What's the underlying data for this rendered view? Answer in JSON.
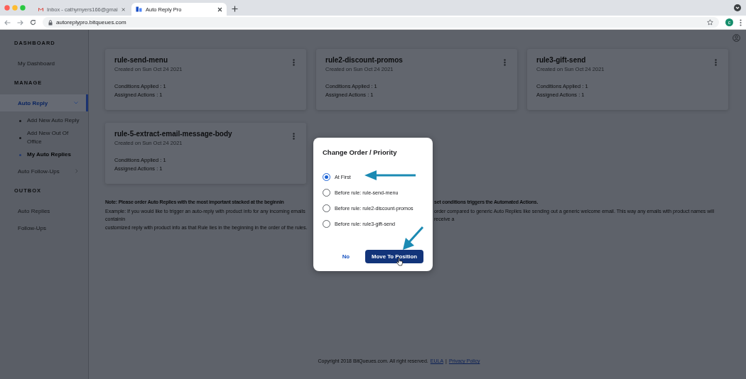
{
  "browser": {
    "tabs": [
      {
        "title": "Inbox - cathymyers166@gmai",
        "selected": false
      },
      {
        "title": "Auto Reply Pro",
        "selected": true
      }
    ],
    "url": "autoreplypro.bitqueues.com",
    "profile_initial": "c"
  },
  "sidebar": {
    "sections": [
      {
        "heading": "DASHBOARD",
        "items": [
          {
            "label": "My Dashboard",
            "selected": false
          }
        ]
      },
      {
        "heading": "MANAGE",
        "items": [
          {
            "label": "Auto Reply",
            "selected": true,
            "expanded": true,
            "children": [
              {
                "label": "Add New Auto Reply",
                "selected": false
              },
              {
                "label": "Add New Out Of Office",
                "selected": false
              },
              {
                "label": "My Auto Replies",
                "selected": true
              }
            ]
          },
          {
            "label": "Auto Follow-Ups",
            "selected": false,
            "expanded": false
          }
        ]
      },
      {
        "heading": "OUTBOX",
        "items": [
          {
            "label": "Auto Replies",
            "selected": false
          },
          {
            "label": "Follow-Ups",
            "selected": false
          }
        ]
      }
    ]
  },
  "rules": [
    {
      "name": "rule-send-menu",
      "created": "Created on Sun Oct 24 2021",
      "conditions": "Conditions Applied : 1",
      "actions": "Assigned Actions : 1"
    },
    {
      "name": "rule2-discount-promos",
      "created": "Created on Sun Oct 24 2021",
      "conditions": "Conditions Applied : 1",
      "actions": "Assigned Actions : 1"
    },
    {
      "name": "rule3-gift-send",
      "created": "Created on Sun Oct 24 2021",
      "conditions": "Conditions Applied : 1",
      "actions": "Assigned Actions : 1"
    },
    {
      "name": "rule-5-extract-email-message-body",
      "created": "Created on Sun Oct 24 2021",
      "conditions": "Conditions Applied : 1",
      "actions": "Assigned Actions : 1"
    }
  ],
  "note": {
    "heading_left": "Note: Please order Auto Replies with the most important stacked at the beginnin",
    "heading_right": "set conditions triggers the Automated Actions.",
    "example_left": "Example: If you would like to trigger an auto-reply with product info for any incoming emails containin",
    "example_right": "order compared to generic Auto Replies like sending out a generic welcome email. This way any emails with product names will receive a",
    "example_line_2": "customized reply with product info as that Rule lies in the beginning in the order of the rules."
  },
  "footer": {
    "copyright": "Copyright 2018 BitQueues.com. All right reserved.",
    "links": [
      "EULA",
      "Privacy Policy"
    ],
    "separator": "|"
  },
  "dialog": {
    "title": "Change Order / Priority",
    "options": [
      {
        "label": "At First",
        "selected": true
      },
      {
        "label": "Before rule: rule-send-menu",
        "selected": false
      },
      {
        "label": "Before rule: rule2-discount-promos",
        "selected": false
      },
      {
        "label": "Before rule: rule3-gift-send",
        "selected": false
      }
    ],
    "buttons": [
      {
        "label": "No",
        "kind": "text"
      },
      {
        "label": "Move To Position",
        "kind": "primary"
      }
    ]
  }
}
